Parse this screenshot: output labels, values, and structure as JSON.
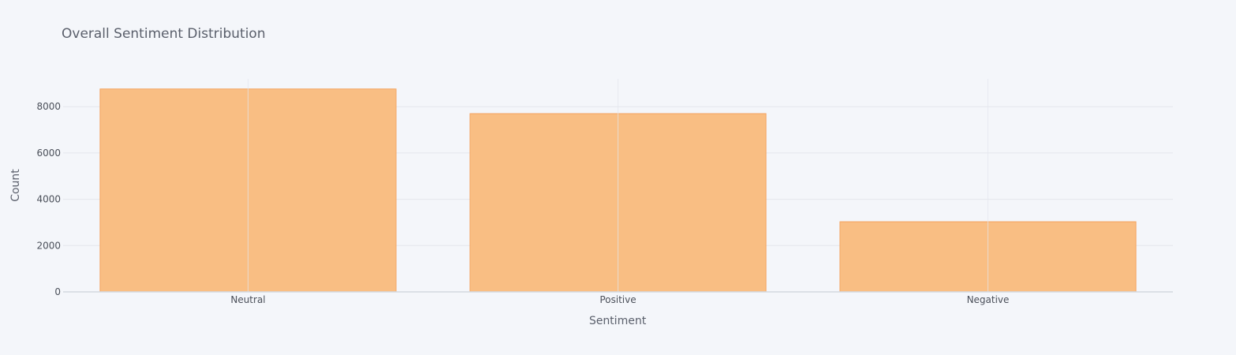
{
  "colors": {
    "background": "#f4f6fa",
    "bar_fill": "#f9be83",
    "bar_stroke": "#f4a460",
    "grid": "#e3e6ec"
  },
  "chart_data": {
    "type": "bar",
    "title": "Overall Sentiment Distribution",
    "xlabel": "Sentiment",
    "ylabel": "Count",
    "categories": [
      "Neutral",
      "Positive",
      "Negative"
    ],
    "values": [
      8765,
      7700,
      3030
    ],
    "ylim": [
      0,
      9200
    ],
    "yticks": [
      0,
      2000,
      4000,
      6000,
      8000
    ],
    "grid": true,
    "legend": "none"
  }
}
